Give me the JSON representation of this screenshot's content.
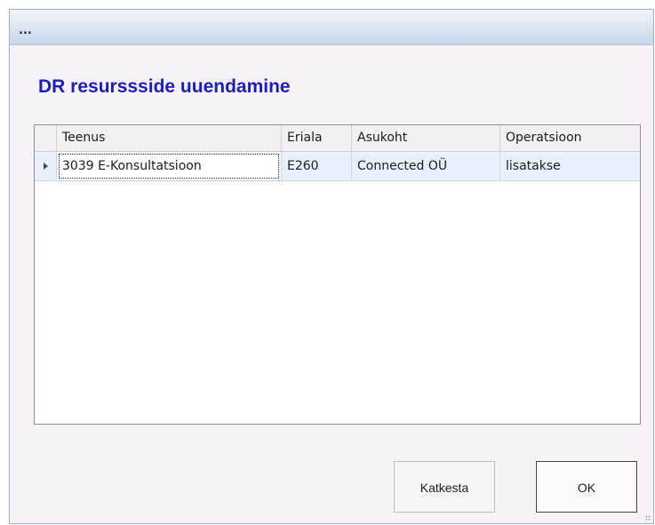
{
  "window": {
    "title": "..."
  },
  "dialog": {
    "heading": "DR resurssside uuendamine"
  },
  "grid": {
    "columns": [
      {
        "label": "Teenus"
      },
      {
        "label": "Eriala"
      },
      {
        "label": "Asukoht"
      },
      {
        "label": "Operatsioon"
      }
    ],
    "rows": [
      {
        "cells": [
          "3039 E-Konsultatsioon",
          "E260",
          "Connected OÜ",
          "lisatakse"
        ]
      }
    ]
  },
  "buttons": {
    "cancel": "Katkesta",
    "ok": "OK"
  },
  "colors": {
    "heading": "#1a1ec0",
    "selected_row": "#e8f1fb",
    "titlebar_top": "#f3f5f9",
    "titlebar_bottom": "#c7d6ea"
  }
}
